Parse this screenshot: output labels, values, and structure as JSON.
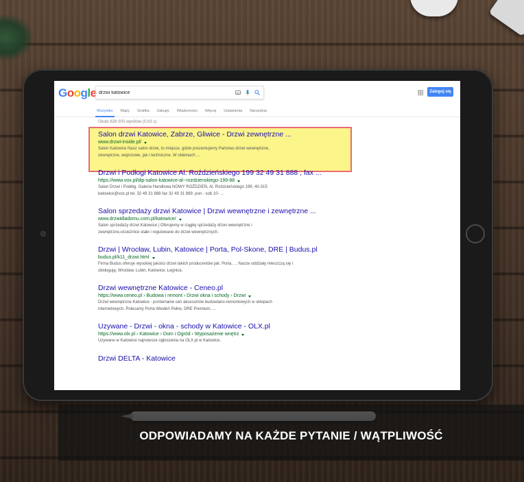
{
  "google": {
    "logo_letters": [
      "G",
      "o",
      "o",
      "g",
      "l",
      "e"
    ],
    "search_query": "drzwi katowice",
    "login_label": "Zaloguj się",
    "tabs": [
      {
        "label": "Wszystko",
        "active": true
      },
      {
        "label": "Mapy",
        "active": false
      },
      {
        "label": "Grafika",
        "active": false
      },
      {
        "label": "Zakupy",
        "active": false
      },
      {
        "label": "Wiadomości",
        "active": false
      },
      {
        "label": "Więcej",
        "active": false
      },
      {
        "label": "Ustawienia",
        "active": false
      },
      {
        "label": "Narzędzia",
        "active": false
      }
    ],
    "result_stats": "Około 626 000 wyników (0,63 s)",
    "results": [
      {
        "title": "Salon drzwi Katowice, Zabrze, Gliwice - Drzwi zewnętrzne ...",
        "url": "www.drzwi-inside.pl/",
        "snippet_1": "Salon Katowice Nasz salon drzwi, to miejsce, gdzie prezentujemy Państwu drzwi wewnętrzne,",
        "snippet_2": "zewnętrzne, wejściowe, jak i techniczne. W okleinach ..."
      },
      {
        "title": "Drzwi i Podłogi Katowice Al. Roździeńskiego 199 32 49 31 888 , fax ...",
        "url": "https://www.vox.pl/dip-salon-katowice-al--rozdzienskiego-199-88",
        "snippet_1": "Salon Drzwi i Podłóg. Galeria Handlowa NOWY ROŹDZIEŃ, Al. Roździeńskiego 199, 40-315",
        "snippet_2": "katowice@vox.pl tel. 32 49 31 888 fax 32 49 31 889. pon - sob 10- ..."
      },
      {
        "title": "Salon sprzedaży drzwi Katowice | Drzwi wewnętrzne i zewnętrzne ...",
        "url": "www.drzwidladomu.com.pl/katowice/",
        "snippet_1": "Salon sprzedaży drzwi Katowice | Oferujemy w ciągłej sprzedaży drzwi wewnętrzne i",
        "snippet_2": "zewnętrzne,ościeżnice stałe i regulowane do drzwi wewnętrznych."
      },
      {
        "title": "Drzwi | Wrocław, Lubin, Katowice | Porta, Pol-Skone, DRE | Budus.pl",
        "url": "budus.pl/k11_drzwi.html",
        "snippet_1": "Firma Budus oferuje wysokiej jakości drzwi takich producentów jak: Porta, ... Nasze oddziały mieszczą się i",
        "snippet_2": "obsługują: Wrocław, Lubin, Katowice, Legnica."
      },
      {
        "title": "Drzwi wewnętrzne Katowice - Ceneo.pl",
        "url": "https://www.ceneo.pl › Budowa i remont › Drzwi okna i schody › Drzwi",
        "snippet_1": "Drzwi wewnętrzne Katowice - porównanie cen akcesoriów budowlano-remontowych w sklepach",
        "snippet_2": "internetowych. Polecamy Porta Wiedeń Pełne, DRE Premium, ..."
      },
      {
        "title": "Uzywane - Drzwi - okna - schody w Katowice - OLX.pl",
        "url": "https://www.olx.pl › Katowice › Dom i Ogród › Wyposażenie wnętrz",
        "snippet_1": "Uzywane w Katowice najnowsze ogłoszenia na OLX.pl w Katowice.",
        "snippet_2": ""
      },
      {
        "title": "Drzwi DELTA - Katowice",
        "url": "",
        "snippet_1": "",
        "snippet_2": ""
      }
    ]
  },
  "banner": {
    "text": "ODPOWIADAMY NA KAŻDE PYTANIE / WĄTPLIWOŚĆ"
  },
  "colors": {
    "link_title": "#1a0dab",
    "url_green": "#006621",
    "highlight_fill": "#fbf58a",
    "highlight_border": "#e86a74",
    "google_blue": "#4285f4"
  }
}
